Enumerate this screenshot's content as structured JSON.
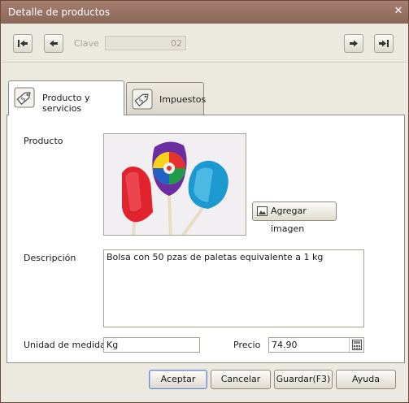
{
  "window": {
    "title": "Detalle de productos",
    "close_glyph": "✕"
  },
  "nav": {
    "clave_label": "Clave",
    "clave_value": "02",
    "buttons": [
      "first-record-icon",
      "prev-record-icon",
      "next-record-icon",
      "last-record-icon"
    ]
  },
  "tabs": [
    {
      "label": "Producto y servicios",
      "icon": "price-tag-icon",
      "active": true
    },
    {
      "label": "Impuestos",
      "icon": "price-tag-icon",
      "active": false
    }
  ],
  "form": {
    "producto_label": "Producto",
    "agregar_imagen_label": "Agregar imagen",
    "descripcion_label": "Descripción",
    "descripcion_value": "Bolsa con 50 pzas de paletas equivalente a 1 kg",
    "unidad_label": "Unidad de medida",
    "unidad_value": "Kg",
    "precio_label": "Precio",
    "precio_value": "74.90"
  },
  "actions": {
    "aceptar": "Aceptar",
    "cancelar": "Cancelar",
    "guardar": "Guardar(F3)",
    "ayuda": "Ayuda"
  },
  "colors": {
    "titlebar": "#8a6656",
    "window_bg": "#ece9e0",
    "panel_bg": "#ffffff"
  }
}
